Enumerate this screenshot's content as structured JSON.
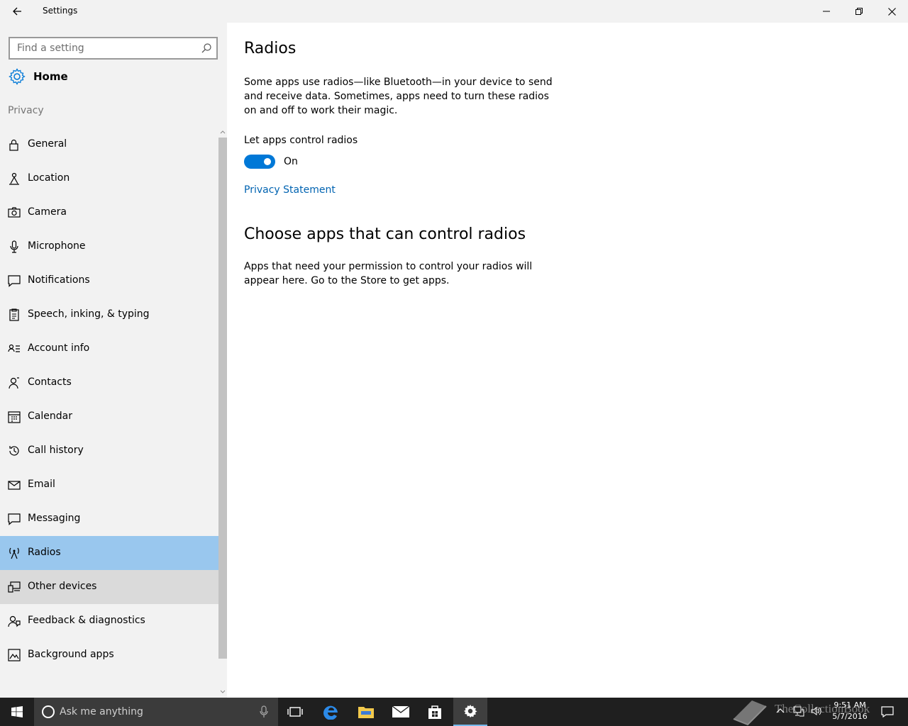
{
  "window": {
    "title": "Settings",
    "back_icon": "back-arrow-icon",
    "controls": [
      "minimize-icon",
      "restore-icon",
      "close-icon"
    ]
  },
  "sidebar": {
    "search_placeholder": "Find a setting",
    "home_label": "Home",
    "section_label": "Privacy",
    "items": [
      {
        "label": "General",
        "icon": "lock-icon"
      },
      {
        "label": "Location",
        "icon": "location-person-icon"
      },
      {
        "label": "Camera",
        "icon": "camera-icon"
      },
      {
        "label": "Microphone",
        "icon": "microphone-icon"
      },
      {
        "label": "Notifications",
        "icon": "notification-icon"
      },
      {
        "label": "Speech, inking, & typing",
        "icon": "clipboard-icon"
      },
      {
        "label": "Account info",
        "icon": "account-info-icon"
      },
      {
        "label": "Contacts",
        "icon": "contacts-icon"
      },
      {
        "label": "Calendar",
        "icon": "calendar-icon"
      },
      {
        "label": "Call history",
        "icon": "history-icon"
      },
      {
        "label": "Email",
        "icon": "email-icon"
      },
      {
        "label": "Messaging",
        "icon": "message-icon"
      },
      {
        "label": "Radios",
        "icon": "radio-tower-icon"
      },
      {
        "label": "Other devices",
        "icon": "devices-icon"
      },
      {
        "label": "Feedback & diagnostics",
        "icon": "feedback-icon"
      },
      {
        "label": "Background apps",
        "icon": "background-apps-icon"
      }
    ],
    "selected": "Radios",
    "hovered": "Other devices"
  },
  "content": {
    "title": "Radios",
    "description": "Some apps use radios—like Bluetooth—in your device to send and receive data. Sometimes, apps need to turn these radios on and off to work their magic.",
    "toggle_label": "Let apps control radios",
    "toggle_state": "On",
    "toggle_on": true,
    "privacy_link": "Privacy Statement",
    "section2_title": "Choose apps that can control radios",
    "section2_text": "Apps that need your permission to control your radios will appear here. Go to the Store to get apps."
  },
  "taskbar": {
    "search_placeholder": "Ask me anything",
    "apps": [
      "task-view-icon",
      "edge-icon",
      "file-explorer-icon",
      "mail-icon",
      "store-icon",
      "settings-gear-icon"
    ],
    "active_app": "settings-gear-icon",
    "time": "9:51 AM",
    "date": "5/7/2016",
    "watermark": "TheCollectionBook"
  },
  "colors": {
    "accent": "#0078d7",
    "selected_bg": "#99c7ee",
    "hover_bg": "#dadada",
    "link": "#0063b1",
    "sidebar_bg": "#f2f2f2",
    "taskbar_bg": "#1f1f1f"
  }
}
